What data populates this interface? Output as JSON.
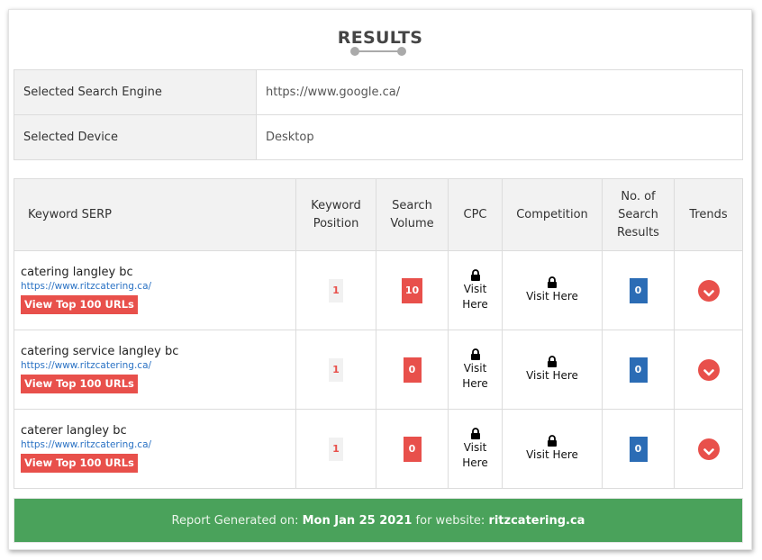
{
  "header": {
    "title": "RESULTS"
  },
  "settings": [
    {
      "label": "Selected Search Engine",
      "value": "https://www.google.ca/"
    },
    {
      "label": "Selected Device",
      "value": "Desktop"
    }
  ],
  "columns": {
    "keyword": "Keyword SERP",
    "position": [
      "Keyword",
      "Position"
    ],
    "volume": [
      "Search",
      "Volume"
    ],
    "cpc": "CPC",
    "competition": "Competition",
    "results": [
      "No. of",
      "Search",
      "Results"
    ],
    "trends": "Trends"
  },
  "rows": [
    {
      "keyword": "catering langley bc",
      "url": "https://www.ritzcatering.ca/",
      "button": "View Top 100 URLs",
      "position": "1",
      "volume": "10",
      "cpc": [
        "Visit",
        "Here"
      ],
      "competition": "Visit Here",
      "results": "0"
    },
    {
      "keyword": "catering service langley bc",
      "url": "https://www.ritzcatering.ca/",
      "button": "View Top 100 URLs",
      "position": "1",
      "volume": "0",
      "cpc": [
        "Visit",
        "Here"
      ],
      "competition": "Visit Here",
      "results": "0"
    },
    {
      "keyword": "caterer langley bc",
      "url": "https://www.ritzcatering.ca/",
      "button": "View Top 100 URLs",
      "position": "1",
      "volume": "0",
      "cpc": [
        "Visit",
        "Here"
      ],
      "competition": "Visit Here",
      "results": "0"
    }
  ],
  "footer": {
    "prefix": "Report Generated on: ",
    "date": "Mon Jan 25 2021",
    "middle": " for website: ",
    "website": "ritzcatering.ca"
  },
  "icons": {
    "lock": "lock-icon",
    "trend": "chevron-down-icon"
  },
  "colors": {
    "accent": "#e8504b",
    "blue": "#2b6cb5",
    "green": "#4aa25b"
  }
}
